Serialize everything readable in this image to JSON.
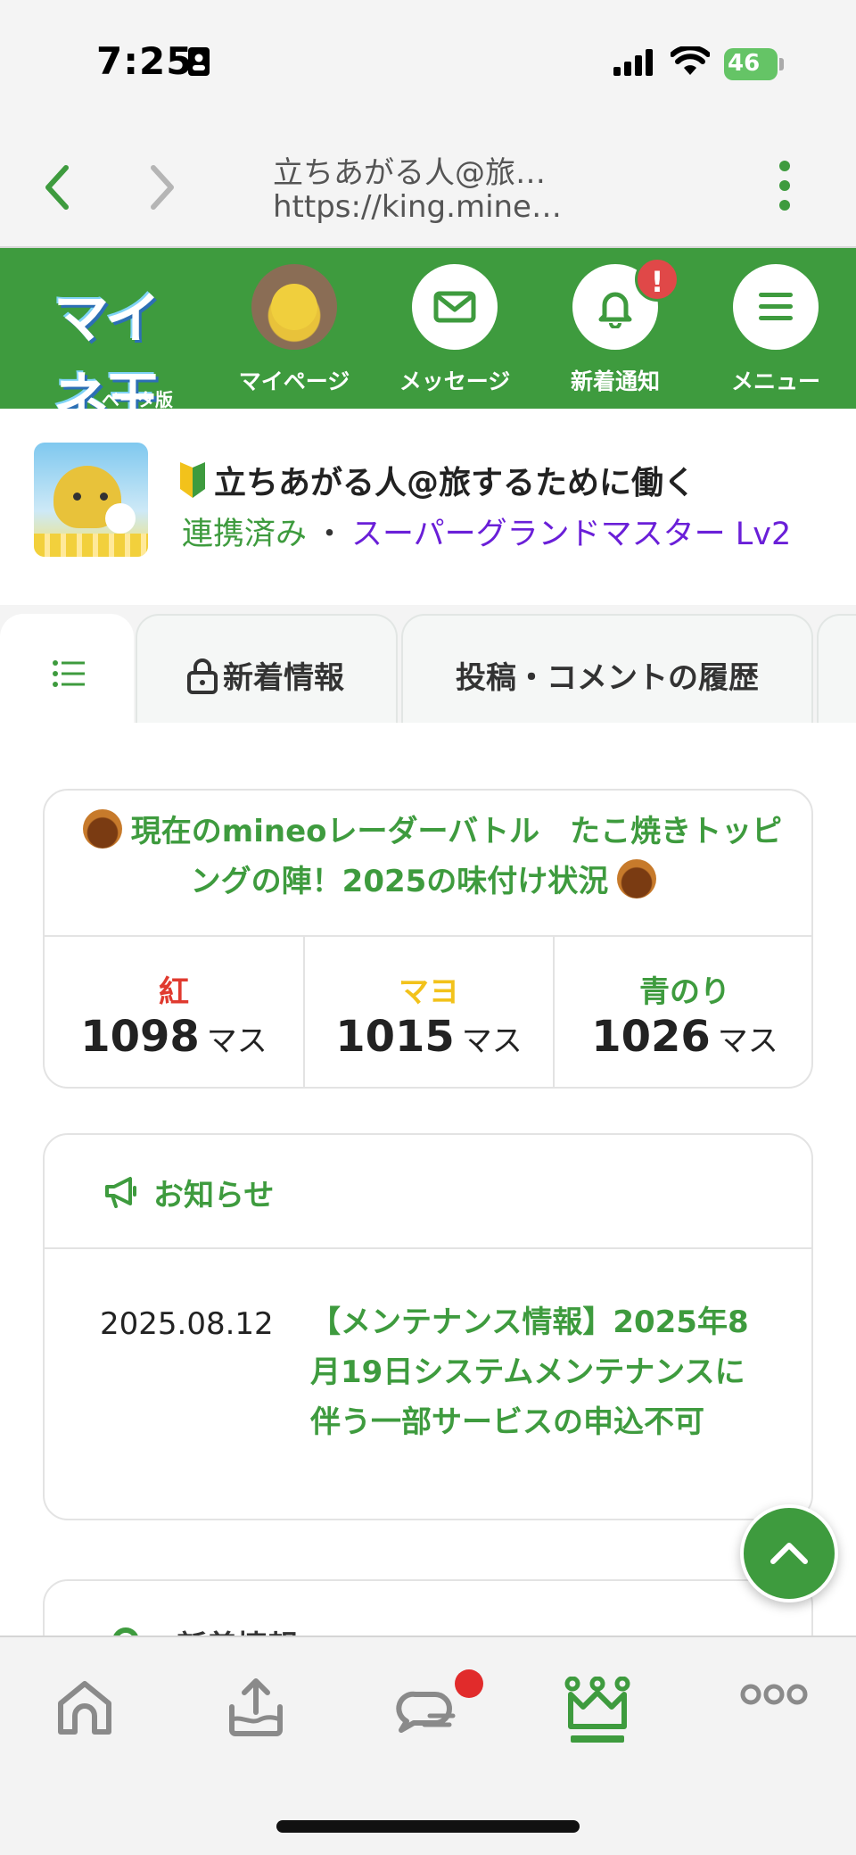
{
  "status_bar": {
    "time": "7:25",
    "battery": "46"
  },
  "browser": {
    "title": "立ちあがる人@旅…",
    "url": "https://king.mine…"
  },
  "site_header": {
    "logo": "マイネ王",
    "logo_sub": "ベータ版",
    "items": [
      {
        "label": "マイページ"
      },
      {
        "label": "メッセージ"
      },
      {
        "label": "新着通知",
        "badge": "!"
      },
      {
        "label": "メニュー"
      }
    ]
  },
  "profile": {
    "name": "立ちあがる人@旅するために働く",
    "status": "連携済み",
    "separator": "・",
    "rank": "スーパーグランドマスター Lv2"
  },
  "tabs": [
    {
      "label": ""
    },
    {
      "label": "新着情報"
    },
    {
      "label": "投稿・コメントの履歴"
    }
  ],
  "battle": {
    "title": "現在のmineoレーダーバトル　たこ焼きトッピングの陣！2025の味付け状況",
    "teams": [
      {
        "name": "紅",
        "color": "#e03a2f",
        "score": "1098",
        "unit": "マス"
      },
      {
        "name": "マヨ",
        "color": "#f2c21b",
        "score": "1015",
        "unit": "マス"
      },
      {
        "name": "青のり",
        "color": "#3e9b3e",
        "score": "1026",
        "unit": "マス"
      }
    ]
  },
  "notice": {
    "title": "お知らせ",
    "date": "2025.08.12",
    "text": "【メンテナンス情報】2025年8月19日システムメンテナンスに伴う一部サービスの申込不可"
  },
  "next_section": {
    "title": "新着情報"
  },
  "bottom_nav": {
    "items": [
      "home-icon",
      "upload-icon",
      "chat-icon",
      "crown-icon",
      "more-icon"
    ],
    "active": "crown-icon"
  },
  "colors": {
    "brand": "#3e9b3e",
    "rank": "#6a1fd8",
    "badge": "#e04848"
  }
}
